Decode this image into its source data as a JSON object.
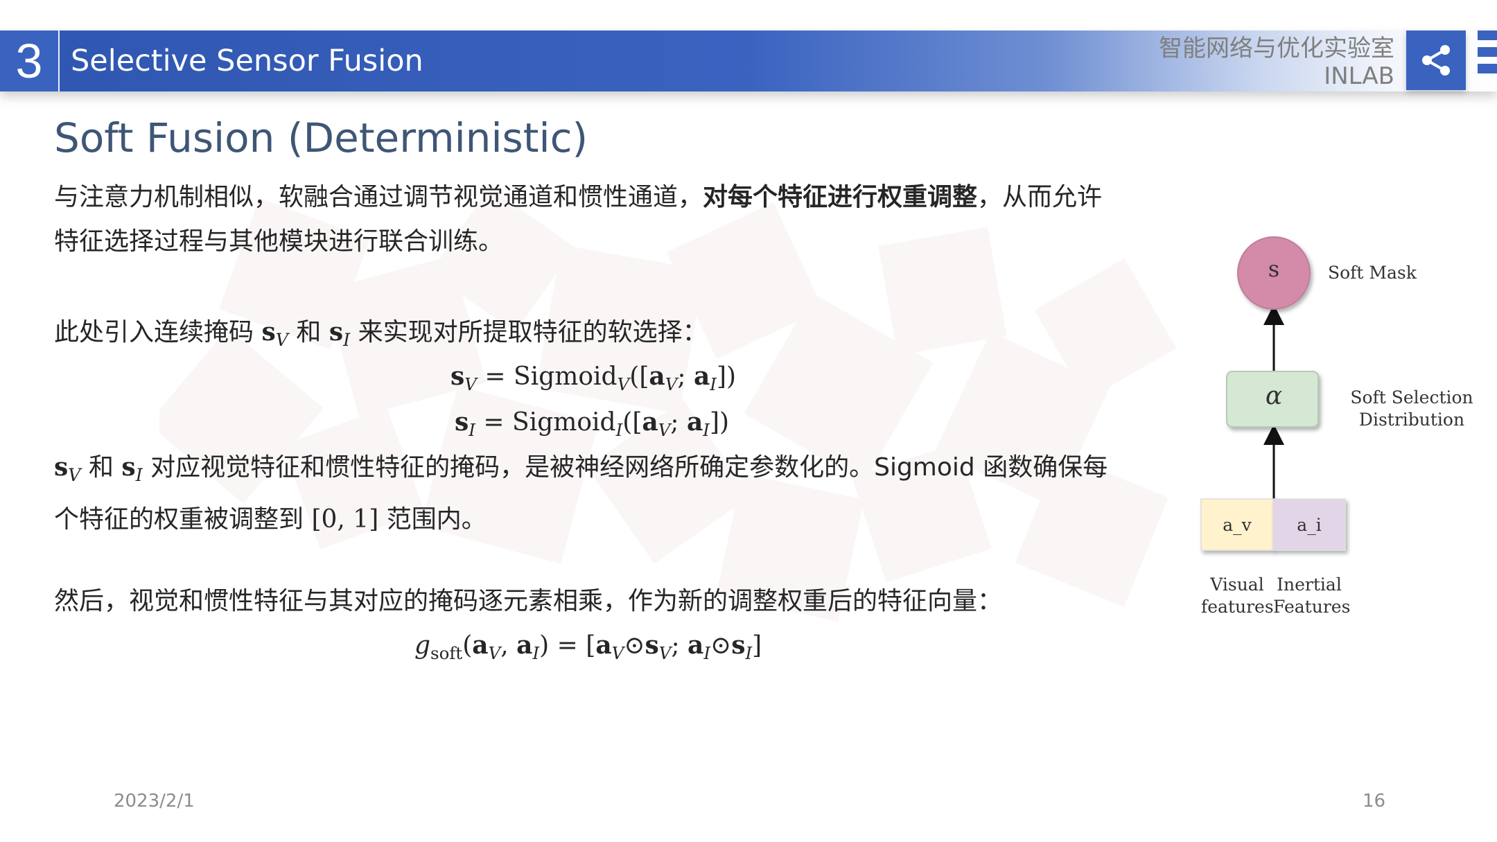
{
  "header": {
    "section_number": "3",
    "title": "Selective Sensor Fusion",
    "lab_name_cn": "智能网络与优化实验室",
    "lab_name_en": "INLAB",
    "share_icon": "share-icon",
    "menu_icon": "menu-icon"
  },
  "content": {
    "subtitle": "Soft Fusion (Deterministic)",
    "para1_part1": "与注意力机制相似，软融合通过调节视觉通道和惯性通道，",
    "para1_bold": "对每个特征进行权重调整",
    "para1_part2": "，从而允许特征选择过程与其他模块进行联合训练。",
    "para2_intro": "此处引入连续掩码",
    "para2_and": "和",
    "para2_rest": "来实现对所提取特征的软选择：",
    "eq1": {
      "lhs": "s",
      "lhs_sub": "V",
      "func": "Sigmoid",
      "func_sub": "V",
      "a1": "a",
      "a1_sub": "V",
      "a2": "a",
      "a2_sub": "I"
    },
    "eq2": {
      "lhs": "s",
      "lhs_sub": "I",
      "func": "Sigmoid",
      "func_sub": "I",
      "a1": "a",
      "a1_sub": "V",
      "a2": "a",
      "a2_sub": "I"
    },
    "para3_and": "和",
    "para3_text1": "对应视觉特征和惯性特征的掩码，是被神经网络所确定参数化的。Sigmoid 函数确保每个特征的权重被调整到",
    "para3_interval": "[0, 1]",
    "para3_text2": "范围内。",
    "para4": "然后，视觉和惯性特征与其对应的掩码逐元素相乘，作为新的调整权重后的特征向量：",
    "eq3": {
      "g": "g",
      "g_sub": "soft"
    }
  },
  "diagram": {
    "mask_node": "s",
    "mask_label": "Soft Mask",
    "alpha_node": "α",
    "alpha_label_line1": "Soft Selection",
    "alpha_label_line2": "Distribution",
    "av_label": "a_v",
    "ai_label": "a_i",
    "visual_line1": "Visual",
    "visual_line2": "features",
    "inertial_line1": "Inertial",
    "inertial_line2": "Features",
    "colors": {
      "mask": "#d48aa9",
      "alpha": "#d5e8d4",
      "av": "#fff2cc",
      "ai": "#e1d5e7"
    }
  },
  "footer": {
    "date": "2023/2/1",
    "page": "16"
  }
}
